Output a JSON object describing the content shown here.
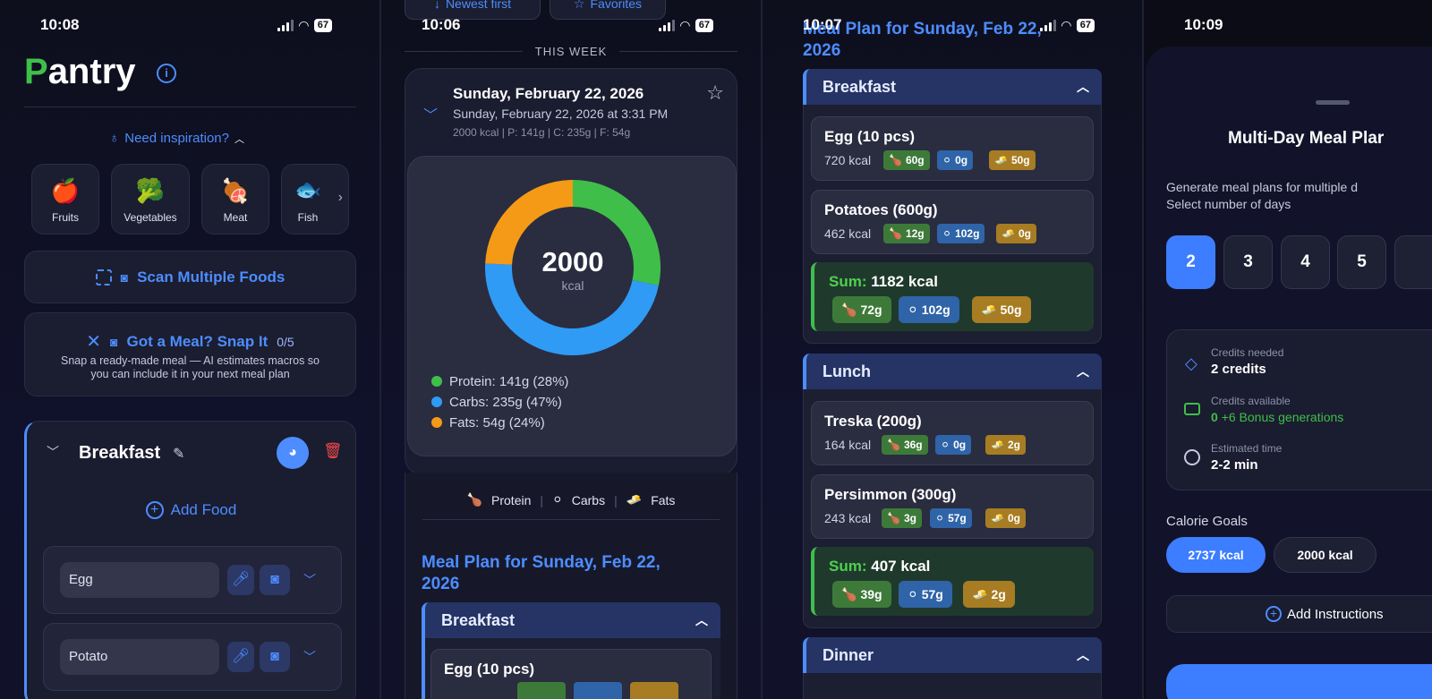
{
  "screen1": {
    "time": "10:08",
    "battery": "67",
    "title_first": "P",
    "title_rest": "antry",
    "inspiration": "Need inspiration?",
    "categories": [
      {
        "label": "Fruits",
        "icon": "🍎"
      },
      {
        "label": "Vegetables",
        "icon": "🥦"
      },
      {
        "label": "Meat",
        "icon": "🍖"
      },
      {
        "label": "Fish",
        "icon": "🐟"
      }
    ],
    "scan_label": "Scan Multiple Foods",
    "snap_title": "Got a Meal? Snap It",
    "snap_count": "0/5",
    "snap_desc_1": "Snap a ready-made meal — AI estimates macros so",
    "snap_desc_2": "you can include it in your next meal plan",
    "breakfast_title": "Breakfast",
    "add_food": "Add Food",
    "inputs": [
      "Egg",
      "Potato"
    ]
  },
  "screen2": {
    "time": "10:06",
    "battery": "67",
    "sort_label": "Newest first",
    "favorites_label": "Favorites",
    "section": "THIS WEEK",
    "plan_title": "Sunday, February 22, 2026",
    "plan_sub": "Sunday, February 22, 2026 at 3:31 PM",
    "plan_macros": "2000 kcal | P: 141g | C: 235g | F: 54g",
    "donut_value": "2000",
    "donut_unit": "kcal",
    "legend": [
      {
        "text": "Protein: 141g (28%)",
        "color": "#3fbf4a"
      },
      {
        "text": "Carbs: 235g (47%)",
        "color": "#2f9bf5"
      },
      {
        "text": "Fats: 54g (24%)",
        "color": "#f59a16"
      }
    ],
    "key_protein": "Protein",
    "key_carbs": "Carbs",
    "key_fats": "Fats",
    "meal_plan_title_1": "Meal Plan for Sunday, Feb 22,",
    "meal_plan_title_2": "2026",
    "meal_header": "Breakfast",
    "first_food": "Egg (10 pcs)"
  },
  "chart_data": {
    "type": "pie",
    "categories": [
      "Protein",
      "Carbs",
      "Fats"
    ],
    "values": [
      28,
      47,
      24
    ],
    "colors": [
      "#3fbf4a",
      "#2f9bf5",
      "#f59a16"
    ],
    "title": "2000",
    "xlabel": "",
    "ylabel": ""
  },
  "screen3": {
    "time": "10:07",
    "battery": "67",
    "title_1": "Meal Plan for Sunday, Feb 22,",
    "title_2": "2026",
    "breakfast": "Breakfast",
    "lunch": "Lunch",
    "dinner": "Dinner",
    "breakfast_items": [
      {
        "name": "Egg (10 pcs)",
        "kcal": "720 kcal",
        "p": "60g",
        "c": "0g",
        "f": "50g"
      },
      {
        "name": "Potatoes (600g)",
        "kcal": "462 kcal",
        "p": "12g",
        "c": "102g",
        "f": "0g"
      }
    ],
    "breakfast_sum": {
      "label": "Sum:",
      "kcal": "1182 kcal",
      "p": "72g",
      "c": "102g",
      "f": "50g"
    },
    "lunch_items": [
      {
        "name": "Treska (200g)",
        "kcal": "164 kcal",
        "p": "36g",
        "c": "0g",
        "f": "2g"
      },
      {
        "name": "Persimmon (300g)",
        "kcal": "243 kcal",
        "p": "3g",
        "c": "57g",
        "f": "0g"
      }
    ],
    "lunch_sum": {
      "label": "Sum:",
      "kcal": "407 kcal",
      "p": "39g",
      "c": "57g",
      "f": "2g"
    }
  },
  "screen4": {
    "time": "10:09",
    "title": "Multi-Day Meal Plar",
    "desc_1": "Generate meal plans for multiple d",
    "desc_2": "Select number of days",
    "days": [
      "2",
      "3",
      "4",
      "5"
    ],
    "credits_needed_label": "Credits needed",
    "credits_needed_value": "2 credits",
    "credits_avail_label": "Credits available",
    "credits_avail_value": "0",
    "credits_bonus": "+6 Bonus generations",
    "est_time_label": "Estimated time",
    "est_time_value": "2-2 min",
    "calorie_goals": "Calorie Goals",
    "goals": [
      "2737 kcal",
      "2000 kcal"
    ],
    "add_instructions": "Add Instructions"
  },
  "colors": {
    "accent": "#4d8dff",
    "green": "#3fbf4a",
    "carbs": "#2f9bf5",
    "fats": "#f59a16"
  }
}
